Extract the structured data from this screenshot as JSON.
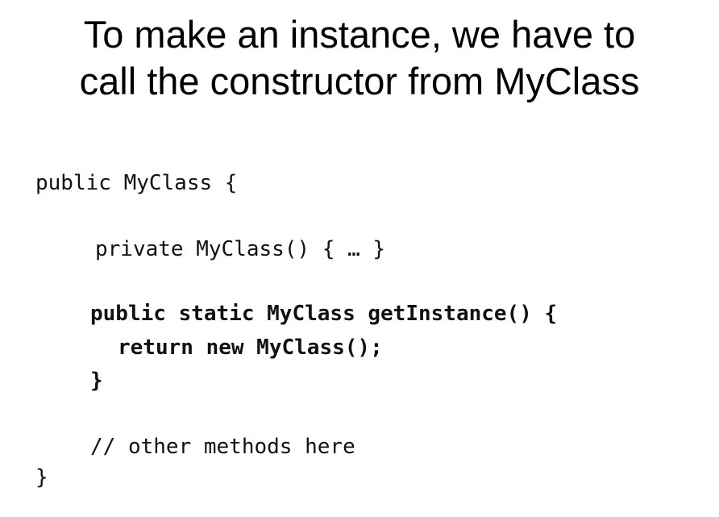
{
  "slide": {
    "title_lines": [
      "To make an instance, we have to",
      "call the constructor from MyClass"
    ],
    "code": {
      "class_decl": "public MyClass {",
      "constructor": "private MyClass() { … }",
      "method_decl": "public static MyClass getInstance() {",
      "method_body": "return new MyClass();",
      "method_close": "}",
      "comment": "// other methods here",
      "class_close": "}"
    }
  }
}
